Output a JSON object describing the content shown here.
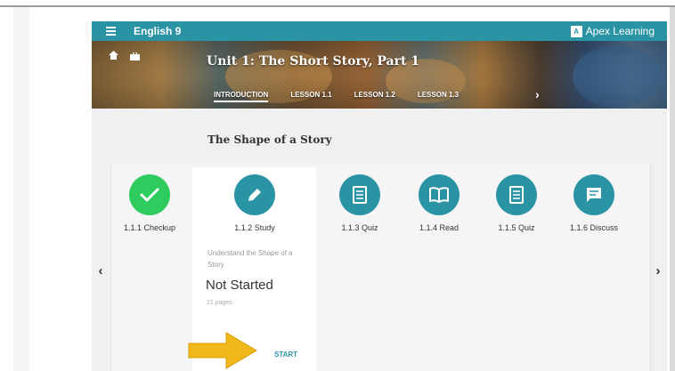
{
  "header": {
    "course_title": "English 9",
    "brand": "Apex Learning"
  },
  "banner": {
    "unit_title": "Unit 1: The Short Story, Part 1",
    "lessons": [
      "INTRODUCTION",
      "LESSON 1.1",
      "LESSON 1.2",
      "LESSON 1.3"
    ]
  },
  "section": {
    "title": "The Shape of a Story"
  },
  "activities": [
    {
      "label": "1.1.1 Checkup",
      "icon": "checkmark-icon",
      "color": "#2ecc5e"
    },
    {
      "label": "1.1.2 Study",
      "icon": "pencil-icon",
      "color": "#2a93a4"
    },
    {
      "label": "1.1.3 Quiz",
      "icon": "quiz-icon",
      "color": "#2a93a4"
    },
    {
      "label": "1.1.4 Read",
      "icon": "book-icon",
      "color": "#2a93a4"
    },
    {
      "label": "1.1.5 Quiz",
      "icon": "quiz-icon",
      "color": "#2a93a4"
    },
    {
      "label": "1.1.6 Discuss",
      "icon": "chat-icon",
      "color": "#2a93a4"
    }
  ],
  "study_card": {
    "description": "Understand the Shape of a Story",
    "status": "Not Started",
    "pages": "21 pages",
    "action": "START"
  },
  "carousel": {
    "prev": "‹",
    "next": "›"
  },
  "colors": {
    "accent": "#2a93a4",
    "complete": "#2ecc5e",
    "pointer_arrow": "#f0b81a"
  }
}
